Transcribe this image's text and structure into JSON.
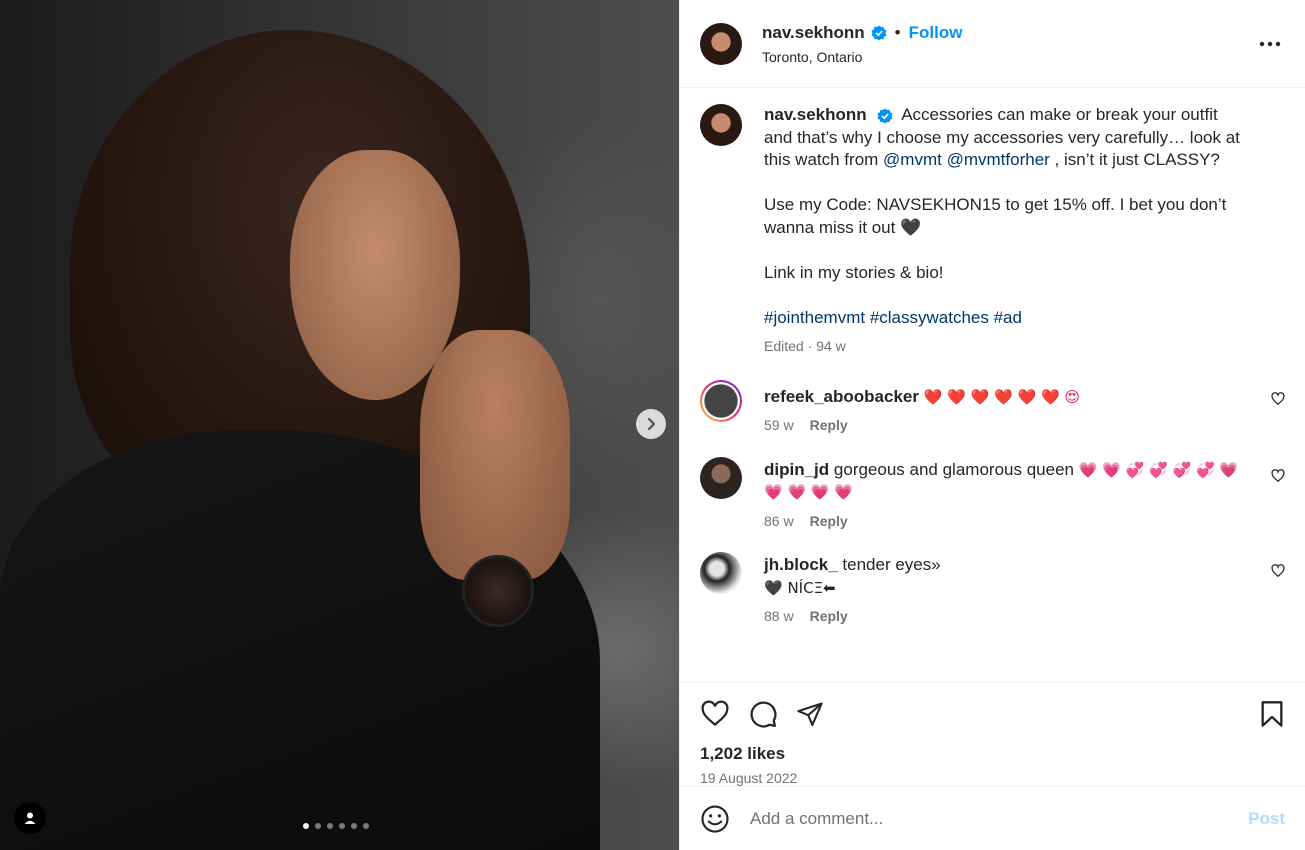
{
  "post": {
    "username": "nav.sekhonn",
    "location": "Toronto, Ontario",
    "follow_label": "Follow",
    "bullet": "•",
    "caption_text_1": "Accessories can make or break your outfit and that’s why I choose my accessories very carefully… look at this watch from",
    "mention_1": "@mvmt",
    "mention_2": "@mvmtforher",
    "caption_text_2": ", isn’t it just CLASSY?",
    "caption_para_2": "Use my Code: NAVSEKHON15 to get 15% off. I bet you don’t wanna miss it out",
    "caption_para_2_emoji": "🖤",
    "caption_para_3": "Link in my stories & bio!",
    "hashtags": "#jointhemvmt #classywatches #ad",
    "edited_meta": "Edited · 94 w"
  },
  "comments": [
    {
      "username": "refeek_aboobacker",
      "text": "",
      "emoji": "❤️ ❤️ ❤️ ❤️ ❤️ ❤️ 😍",
      "age": "59 w",
      "reply": "Reply"
    },
    {
      "username": "dipin_jd",
      "text": "gorgeous and glamorous queen",
      "emoji": "💗 💗 💞 💞 💞 💞 💗 💗 💗 💗 💗",
      "age": "86 w",
      "reply": "Reply"
    },
    {
      "username": "jh.block_",
      "text": "tender eyes»",
      "text2": "🖤 NÍCΞ⬅",
      "age": "88 w",
      "reply": "Reply"
    }
  ],
  "footer": {
    "likes": "1,202 likes",
    "date": "19 August 2022",
    "comment_placeholder": "Add a comment...",
    "post_label": "Post"
  },
  "carousel": {
    "current_slide": 1,
    "total_slides": 6
  },
  "icons": {
    "heart": "heart-icon",
    "comment": "comment-icon",
    "share": "share-icon",
    "save": "bookmark-icon",
    "emoji": "smiley-icon",
    "more": "more-icon",
    "next": "chevron-right-icon",
    "verified": "verified-badge-icon",
    "user_tag": "person-icon"
  },
  "colors": {
    "accent": "#0095f6",
    "verified": "#0095f6",
    "link": "#00376b",
    "muted": "#737373"
  }
}
